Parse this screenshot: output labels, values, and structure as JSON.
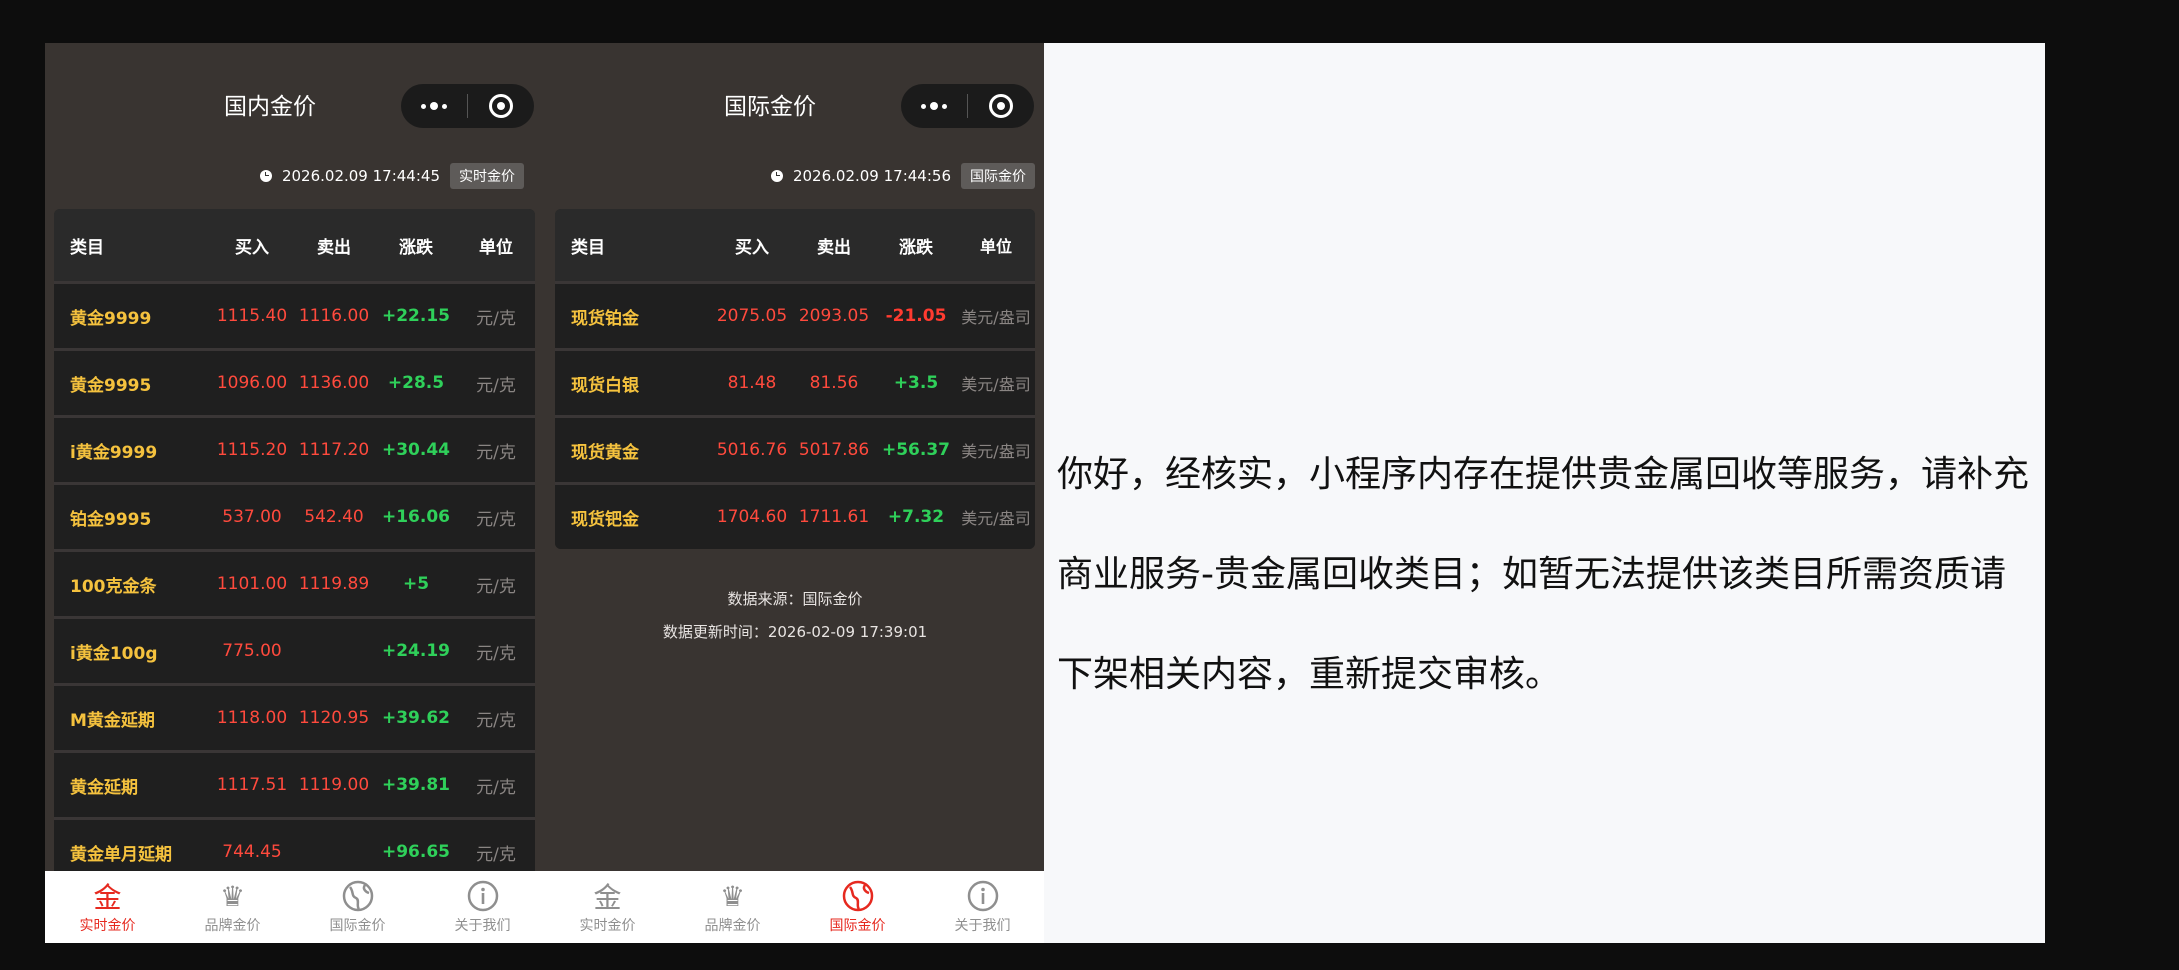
{
  "domestic": {
    "title": "国内金价",
    "timestamp": "2026.02.09 17:44:45",
    "badge": "实时金价",
    "headers": [
      "类目",
      "买入",
      "卖出",
      "涨跌",
      "单位"
    ],
    "rows": [
      {
        "name": "黄金9999",
        "buy": "1115.40",
        "sell": "1116.00",
        "change": "+22.15",
        "unit": "元/克"
      },
      {
        "name": "黄金9995",
        "buy": "1096.00",
        "sell": "1136.00",
        "change": "+28.5",
        "unit": "元/克"
      },
      {
        "name": "i黄金9999",
        "buy": "1115.20",
        "sell": "1117.20",
        "change": "+30.44",
        "unit": "元/克"
      },
      {
        "name": "铂金9995",
        "buy": "537.00",
        "sell": "542.40",
        "change": "+16.06",
        "unit": "元/克"
      },
      {
        "name": "100克金条",
        "buy": "1101.00",
        "sell": "1119.89",
        "change": "+5",
        "unit": "元/克"
      },
      {
        "name": "i黄金100g",
        "buy": "775.00",
        "sell": "",
        "change": "+24.19",
        "unit": "元/克"
      },
      {
        "name": "M黄金延期",
        "buy": "1118.00",
        "sell": "1120.95",
        "change": "+39.62",
        "unit": "元/克"
      },
      {
        "name": "黄金延期",
        "buy": "1117.51",
        "sell": "1119.00",
        "change": "+39.81",
        "unit": "元/克"
      },
      {
        "name": "黄金单月延期",
        "buy": "744.45",
        "sell": "",
        "change": "+96.65",
        "unit": "元/克"
      }
    ],
    "tabs": [
      "实时金价",
      "品牌金价",
      "国际金价",
      "关于我们"
    ],
    "active_tab": 0
  },
  "intl": {
    "title": "国际金价",
    "timestamp": "2026.02.09 17:44:56",
    "badge": "国际金价",
    "headers": [
      "类目",
      "买入",
      "卖出",
      "涨跌",
      "单位"
    ],
    "rows": [
      {
        "name": "现货铂金",
        "buy": "2075.05",
        "sell": "2093.05",
        "change": "-21.05",
        "unit": "美元/盎司"
      },
      {
        "name": "现货白银",
        "buy": "81.48",
        "sell": "81.56",
        "change": "+3.5",
        "unit": "美元/盎司"
      },
      {
        "name": "现货黄金",
        "buy": "5016.76",
        "sell": "5017.86",
        "change": "+56.37",
        "unit": "美元/盎司"
      },
      {
        "name": "现货钯金",
        "buy": "1704.60",
        "sell": "1711.61",
        "change": "+7.32",
        "unit": "美元/盎司"
      }
    ],
    "source_line1": "数据来源：国际金价",
    "source_line2": "数据更新时间：2026-02-09 17:39:01",
    "tabs": [
      "实时金价",
      "品牌金价",
      "国际金价",
      "关于我们"
    ],
    "active_tab": 2
  },
  "notice": {
    "text": "你好，经核实，小程序内存在提供贵金属回收等服务，请补充商业服务-贵金属回收类目；如暂无法提供该类目所需资质请下架相关内容，重新提交审核。"
  },
  "colors": {
    "panel_bg": "#393431",
    "gold_text": "#f5c23e",
    "price_red": "#ff4a3d",
    "up_green": "#2fd05a",
    "active_tab_red": "#e6291f"
  },
  "icons": [
    "gold-char-icon",
    "crown-icon",
    "globe-icon",
    "info-icon"
  ]
}
